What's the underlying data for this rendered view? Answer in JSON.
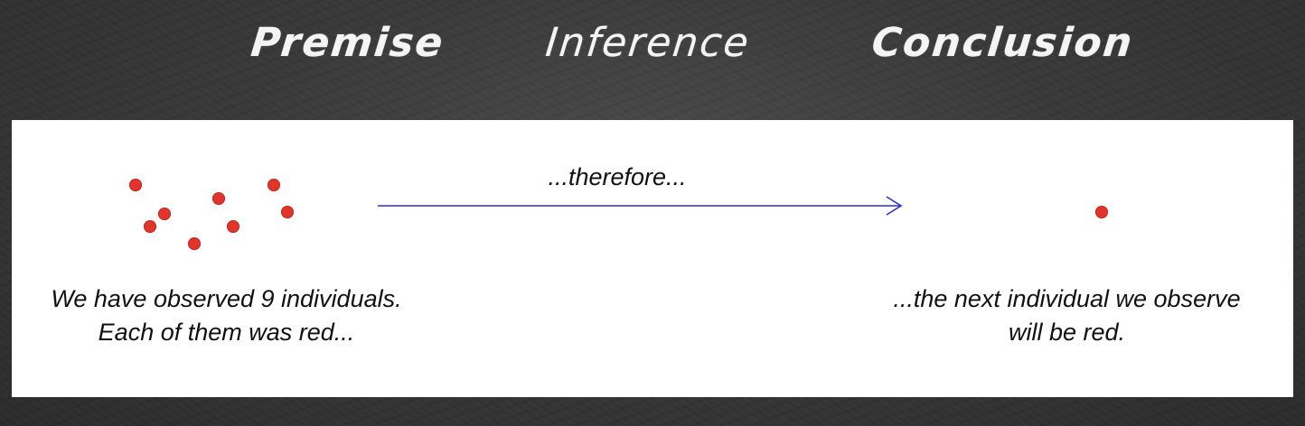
{
  "headers": {
    "premise": "Premise",
    "inference": "Inference",
    "conclusion": "Conclusion"
  },
  "premise": {
    "line1": "We have observed 9 individuals.",
    "line2": "Each of them was red..."
  },
  "inference": {
    "label": "...therefore..."
  },
  "conclusion": {
    "line1": "...the next individual we observe",
    "line2": "will be red."
  },
  "colors": {
    "dot": "#e0352b",
    "arrow": "#2f2fd0",
    "board": "#ffffff",
    "background": "#3a3a3a"
  }
}
